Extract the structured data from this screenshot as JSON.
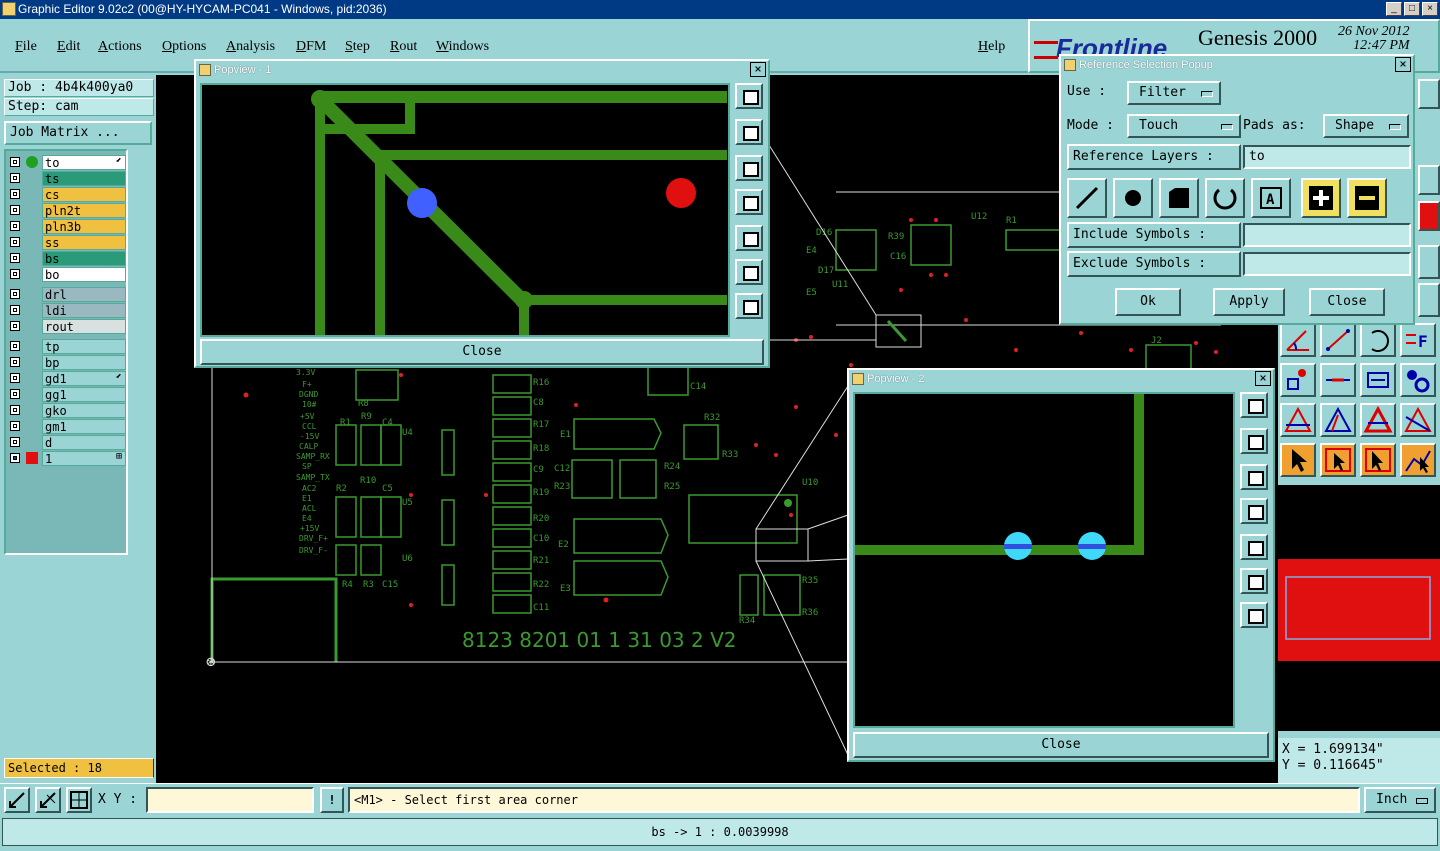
{
  "window": {
    "title": "Graphic Editor 9.02c2 (00@HY-HYCAM-PC041 - Windows, pid:2036)",
    "btn_min": "_",
    "btn_max": "□",
    "btn_close": "×"
  },
  "menu": {
    "file": "File",
    "edit": "Edit",
    "actions": "Actions",
    "options": "Options",
    "analysis": "Analysis",
    "dfm": "DFM",
    "step": "Step",
    "rout": "Rout",
    "windows": "Windows",
    "help": "Help"
  },
  "brand": {
    "logo": "Frontline",
    "product": "Genesis 2000",
    "date": "26 Nov 2012",
    "time": "12:47 PM"
  },
  "job": {
    "job_label": "Job : 4b4k400ya0",
    "step_label": "Step: cam",
    "matrix_button": "Job Matrix ..."
  },
  "layers": [
    {
      "name": "to",
      "color": "#ffffff",
      "dot": "#20a020",
      "sym": "⬋"
    },
    {
      "name": "ts",
      "color": "#2a9a78",
      "dot": "",
      "sym": ""
    },
    {
      "name": "cs",
      "color": "#f0c040",
      "dot": "",
      "sym": ""
    },
    {
      "name": "pln2t",
      "color": "#f0c040",
      "dot": "",
      "sym": ""
    },
    {
      "name": "pln3b",
      "color": "#f0c040",
      "dot": "",
      "sym": ""
    },
    {
      "name": "ss",
      "color": "#f0c040",
      "dot": "",
      "sym": ""
    },
    {
      "name": "bs",
      "color": "#2a9a78",
      "dot": "",
      "sym": ""
    },
    {
      "name": "bo",
      "color": "#ffffff",
      "dot": "",
      "sym": ""
    },
    {
      "name": "drl",
      "color": "#9ab8c0",
      "dot": "",
      "sym": ""
    },
    {
      "name": "ldi",
      "color": "#9ab8c0",
      "dot": "",
      "sym": ""
    },
    {
      "name": "rout",
      "color": "#d8e0e0",
      "dot": "",
      "sym": ""
    },
    {
      "name": "tp",
      "color": "#9ad4d4",
      "dot": "",
      "sym": ""
    },
    {
      "name": "bp",
      "color": "#9ad4d4",
      "dot": "",
      "sym": ""
    },
    {
      "name": "gd1",
      "color": "#9ad4d4",
      "dot": "",
      "sym": "⬋"
    },
    {
      "name": "gg1",
      "color": "#9ad4d4",
      "dot": "",
      "sym": ""
    },
    {
      "name": "gko",
      "color": "#9ad4d4",
      "dot": "",
      "sym": ""
    },
    {
      "name": "gm1",
      "color": "#9ad4d4",
      "dot": "",
      "sym": ""
    },
    {
      "name": "d",
      "color": "#9ad4d4",
      "dot": "",
      "sym": ""
    },
    {
      "name": "1",
      "color": "#9ad4d4",
      "dot": "",
      "sym": "⊞"
    }
  ],
  "selected": "Selected : 18",
  "popview1": {
    "title": "Popview - 1",
    "close": "Close",
    "x": "×"
  },
  "popview2": {
    "title": "Popview - 2",
    "close": "Close",
    "x": "×"
  },
  "refpopup": {
    "title": "Reference Selection Popup",
    "x": "×",
    "use_label": "Use  :",
    "use_value": "Filter",
    "mode_label": "Mode :",
    "mode_value": "Touch",
    "pads_label": "Pads as:",
    "pads_value": "Shape",
    "ref_layers_label": "Reference Layers :",
    "ref_layers_value": "to",
    "include_label": "Include Symbols :",
    "include_value": "",
    "exclude_label": "Exclude Symbols :",
    "exclude_value": "",
    "ok": "Ok",
    "apply": "Apply",
    "close": "Close"
  },
  "board": {
    "marking": "8123  8201  01  1  31  03  2    V2",
    "designators": [
      "R16",
      "C8",
      "R17",
      "R18",
      "C9",
      "R19",
      "R20",
      "C10",
      "R21",
      "R22",
      "C11",
      "C12",
      "R23",
      "R24",
      "R25",
      "R32",
      "R33",
      "D1",
      "E1",
      "E2",
      "E3",
      "C14",
      "U10",
      "R35",
      "R34",
      "R36",
      "U4",
      "U5",
      "U6",
      "R1",
      "R9",
      "C4",
      "R8",
      "R2",
      "R10",
      "C5",
      "R4",
      "R3",
      "C15",
      "D16",
      "D17",
      "U11",
      "R39",
      "C16",
      "U12",
      "R1",
      "E4",
      "E5",
      "J2"
    ],
    "netlabels": [
      "3.3V",
      "F+",
      "DGND",
      "10#",
      "+5V",
      "CCL",
      "-15V",
      "CALP",
      "SAMP_RX",
      "SP",
      "SAMP_TX",
      "AC2",
      "E1",
      "ACL",
      "E4",
      "+15V",
      "DRV_F+",
      "DRV_F-"
    ]
  },
  "coords": {
    "x": "X =  1.699134\"",
    "y": "Y =  0.116645\""
  },
  "bottom": {
    "xy_label": "X Y :",
    "xy_value": "",
    "exclaim": "!",
    "prompt": "<M1> - Select first area corner",
    "units": "Inch"
  },
  "status": "bs -> 1 : 0.0039998"
}
